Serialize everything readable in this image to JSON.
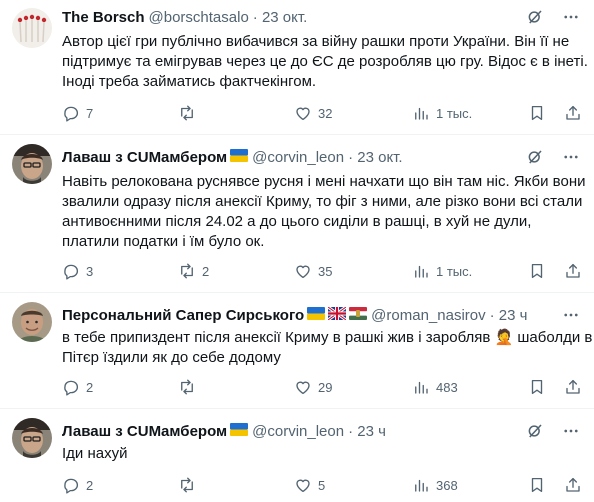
{
  "posts": [
    {
      "name": "The Borsch",
      "handle": "@borschtasalo",
      "time": "· 23 окт.",
      "flags": [],
      "text": [
        "Автор цієї гри публічно вибачився за війну рашки проти України. Він її не",
        "підтримує та емігрував через це до ЄС де розробляв цю гру. Відос є в інеті.",
        "Іноді треба займатись фактчекінгом."
      ],
      "replies": "7",
      "reposts": "",
      "likes": "32",
      "views": "1 тыс."
    },
    {
      "name": "Лаваш з CUMамбером",
      "handle": "@corvin_leon",
      "time": "· 23 окт.",
      "flags": [
        "ua"
      ],
      "text": [
        "Навіть релокована руснявсе русня і мені начхати що він там ніс. Якби вони",
        "звалили одразу після анексії Криму, то фіг з ними, але різко вони всі стали",
        "антивоєнними після 24.02 а до цього сиділи в рашці, в хуй не дули,",
        "платили податки і їм було ок."
      ],
      "replies": "3",
      "reposts": "2",
      "likes": "35",
      "views": "1 тыс."
    },
    {
      "name": "Персональний Сапер Сирського",
      "handle": "@roman_nasirov",
      "time": "· 23 ч",
      "flags": [
        "ua",
        "uk",
        "hu"
      ],
      "text": [
        "в тебе припиздент після анексії Криму в рашкі жив і заробляв 🤦 шаболди в",
        "Пітєр їздили як до себе додому"
      ],
      "replies": "2",
      "reposts": "",
      "likes": "29",
      "views": "483"
    },
    {
      "name": "Лаваш з CUMамбером",
      "handle": "@corvin_leon",
      "time": "· 23 ч",
      "flags": [
        "ua"
      ],
      "text": [
        "Іди нахуй"
      ],
      "replies": "2",
      "reposts": "",
      "likes": "5",
      "views": "368"
    }
  ],
  "icons": {
    "reply": "reply-icon",
    "repost": "repost-icon",
    "like": "like-icon",
    "views": "views-icon",
    "bookmark": "bookmark-icon",
    "share": "share-icon",
    "grok": "grok-icon",
    "more": "more-icon"
  },
  "colors": {
    "name": "#0f1419",
    "meta": "#536471",
    "separator": "#eff3f4"
  }
}
